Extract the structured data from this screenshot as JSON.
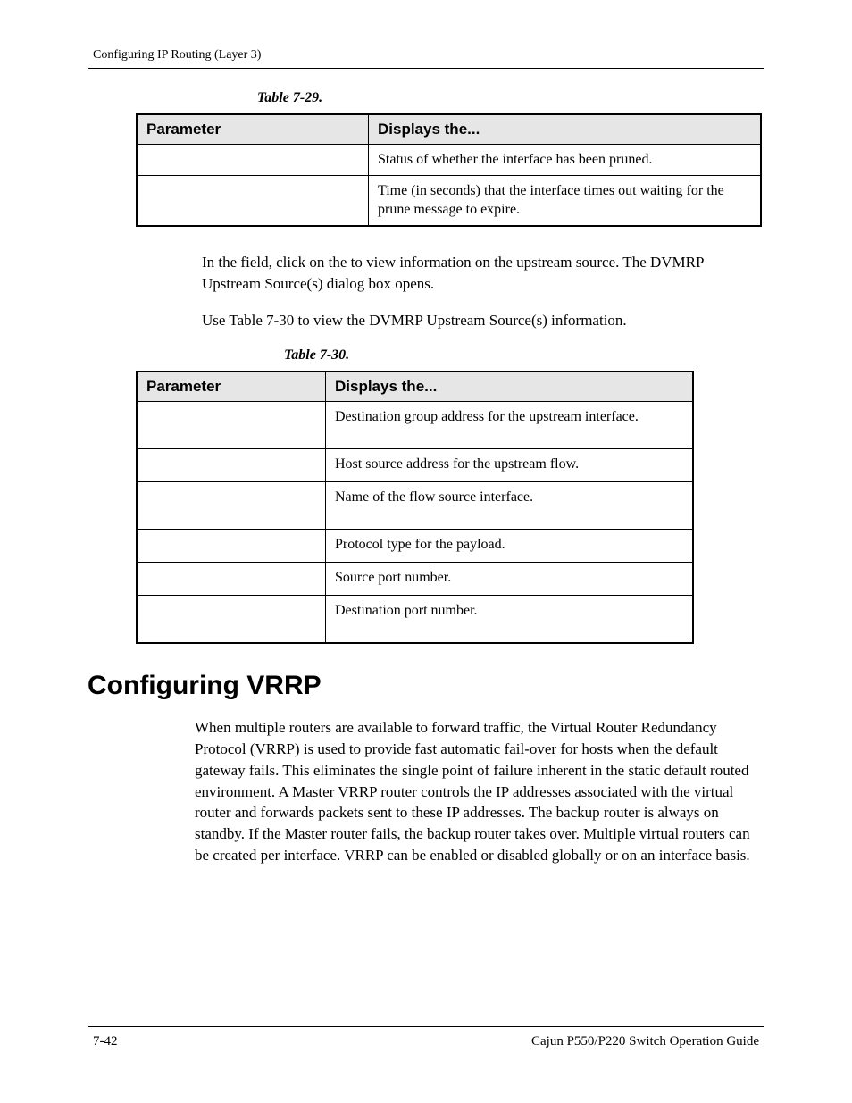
{
  "running_head": "Configuring IP Routing (Layer 3)",
  "table29": {
    "caption": "Table 7-29.",
    "headers": {
      "c1": "Parameter",
      "c2": "Displays the..."
    },
    "rows": [
      {
        "c1": "",
        "c2": "Status of whether the interface has been pruned."
      },
      {
        "c1": "",
        "c2": "Time (in seconds) that the interface times out waiting for the prune message to expire."
      }
    ]
  },
  "para1": "In the                                       field, click on the                  to view information on the upstream source. The DVMRP Upstream Source(s) dialog box opens.",
  "para2": "Use Table 7-30 to view the DVMRP Upstream Source(s) information.",
  "table30": {
    "caption": "Table 7-30.",
    "headers": {
      "c1": "Parameter",
      "c2": "Displays the..."
    },
    "rows": [
      {
        "c1": "",
        "c2": "Destination group address for the upstream interface.",
        "tall": true
      },
      {
        "c1": "",
        "c2": "Host source address for the upstream flow."
      },
      {
        "c1": "",
        "c2": "Name of the flow source interface.",
        "tall": true
      },
      {
        "c1": "",
        "c2": "Protocol type for the payload."
      },
      {
        "c1": "",
        "c2": "Source port number."
      },
      {
        "c1": "",
        "c2": "Destination port number.",
        "tall": true
      }
    ]
  },
  "section_heading": "Configuring VRRP",
  "section_body": "When multiple routers are available to forward traffic, the Virtual Router Redundancy Protocol (VRRP) is used to provide fast automatic fail-over for hosts when the default gateway fails. This eliminates the single point of failure inherent in the static default routed environment. A Master VRRP router controls the IP addresses associated with the virtual router and forwards packets sent to these IP addresses. The backup router is always on standby. If the Master router fails, the backup router takes over. Multiple virtual routers can be created per interface. VRRP can be enabled or disabled globally or on an interface basis.",
  "footer": {
    "left": "7-42",
    "right": "Cajun P550/P220 Switch Operation Guide"
  }
}
